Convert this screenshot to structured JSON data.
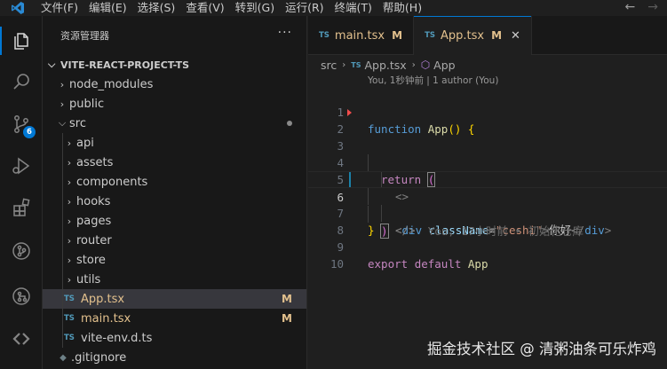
{
  "menu": [
    "文件(F)",
    "编辑(E)",
    "选择(S)",
    "查看(V)",
    "转到(G)",
    "运行(R)",
    "终端(T)",
    "帮助(H)"
  ],
  "nav": {
    "back": "←",
    "forward": "→"
  },
  "activity": {
    "scm_badge": "6"
  },
  "explorer": {
    "title": "资源管理器",
    "more": "···",
    "project": "VITE-REACT-PROJECT-TS",
    "items": [
      {
        "label": "node_modules"
      },
      {
        "label": "public"
      },
      {
        "label": "src"
      },
      {
        "label": "api"
      },
      {
        "label": "assets"
      },
      {
        "label": "components"
      },
      {
        "label": "hooks"
      },
      {
        "label": "pages"
      },
      {
        "label": "router"
      },
      {
        "label": "store"
      },
      {
        "label": "utils"
      },
      {
        "label": "App.tsx",
        "badge": "TS",
        "status": "M"
      },
      {
        "label": "main.tsx",
        "badge": "TS",
        "status": "M"
      },
      {
        "label": "vite-env.d.ts",
        "badge": "TS"
      },
      {
        "label": ".gitignore"
      }
    ]
  },
  "tabs": [
    {
      "label": "main.tsx",
      "badge": "TS",
      "status": "M"
    },
    {
      "label": "App.tsx",
      "badge": "TS",
      "status": "M",
      "close": "✕"
    }
  ],
  "breadcrumb": {
    "folder": "src",
    "badge": "TS",
    "file": "App.tsx",
    "symbol": "App"
  },
  "codelens": "You, 1秒钟前 | 1 author (You)",
  "code": {
    "line_numbers": [
      "1",
      "2",
      "3",
      "4",
      "5",
      "6",
      "7",
      "8",
      "9",
      "10"
    ],
    "l1_kw": "function",
    "l1_fn": "App",
    "l1_paren": "()",
    "l1_brace": "{",
    "l2_kw": "return",
    "l2_paren": "(",
    "l3": "<>",
    "l4_lt": "<",
    "l4_tag": "div",
    "l4_attr": "className",
    "l4_eq": "=",
    "l4_str": "\"ceshi\"",
    "l4_gt": ">",
    "l4_text": "你好",
    "l4_close_lt": "</",
    "l4_close_tag": "div",
    "l4_close_gt": ">",
    "l5": "</>",
    "l6_paren": ")",
    "l6_blame": "You, 17小时前 • 初始化仓库",
    "l7": "}",
    "l9_kw1": "export",
    "l9_kw2": "default",
    "l9_name": "App"
  },
  "watermark": "掘金技术社区 @ 清粥油条可乐炸鸡"
}
